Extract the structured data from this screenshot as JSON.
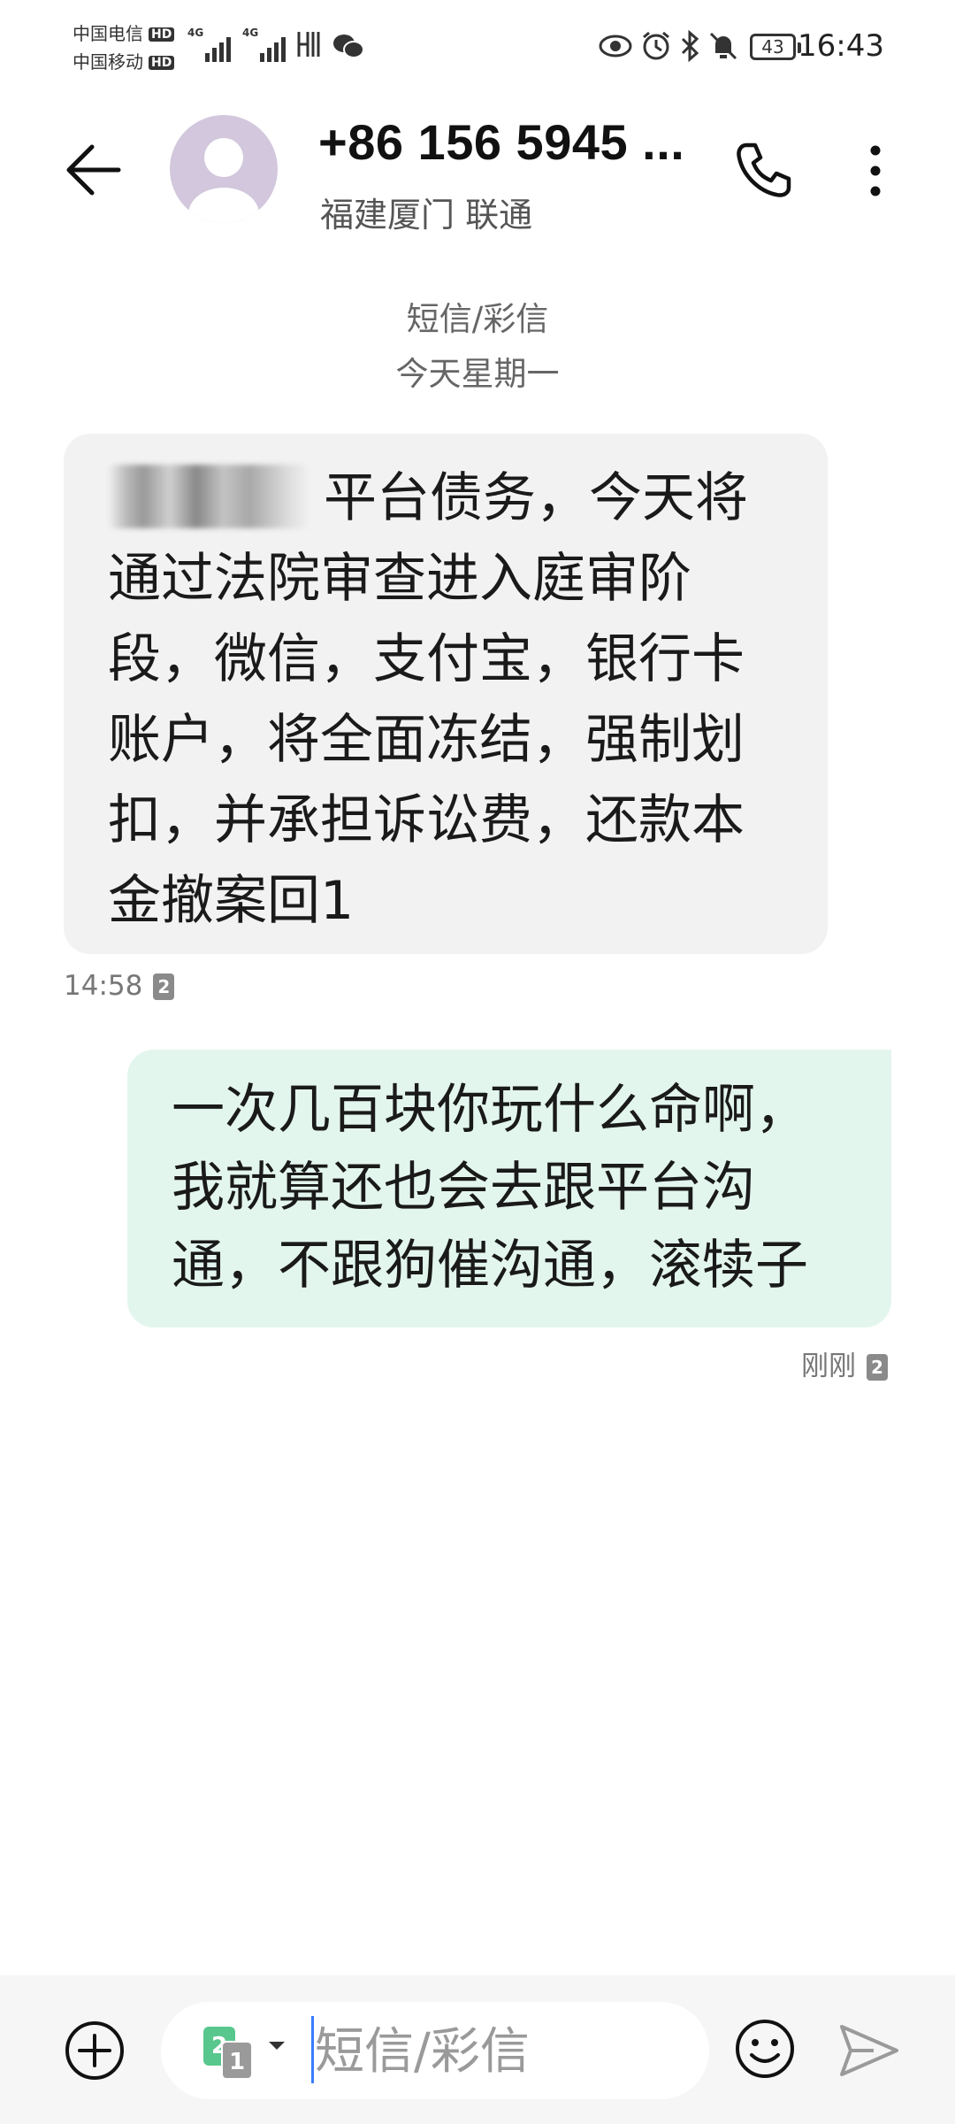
{
  "status_bar": {
    "carrier_1": "中国电信",
    "carrier_2": "中国移动",
    "hd_label": "HD",
    "net_type": "4G",
    "battery": "43",
    "time": "16:43"
  },
  "header": {
    "title": "+86 156 5945 ...",
    "subtitle": "福建厦门 联通"
  },
  "conversation": {
    "type_label": "短信/彩信",
    "date_label": "今天星期一",
    "messages": [
      {
        "direction": "incoming",
        "text_visible": "平台债务，今天将通过法院审查进入庭审阶段，微信，支付宝，银行卡账户，将全面冻结，强制划扣，并承担诉讼费，还款本金撤案回1",
        "time": "14:58",
        "sim": "2"
      },
      {
        "direction": "outgoing",
        "text": "一次几百块你玩什么命啊，我就算还也会去跟平台沟通，不跟狗催沟通，滚犊子",
        "time": "刚刚",
        "sim": "2"
      }
    ]
  },
  "composer": {
    "placeholder": "短信/彩信",
    "sim_primary": "2",
    "sim_secondary": "1"
  },
  "colors": {
    "incoming_bubble": "#f2f2f2",
    "outgoing_bubble": "#e3f6ee",
    "avatar_bg": "#d2c7dc",
    "sim_green": "#58c78d",
    "caret": "#3b7bff"
  },
  "icons": [
    "back-arrow-icon",
    "phone-icon",
    "more-vert-icon",
    "plus-circle-icon",
    "emoji-icon",
    "send-icon",
    "eye-icon",
    "alarm-icon",
    "bluetooth-icon",
    "mute-bell-icon",
    "signal-icon",
    "wechat-icon"
  ]
}
